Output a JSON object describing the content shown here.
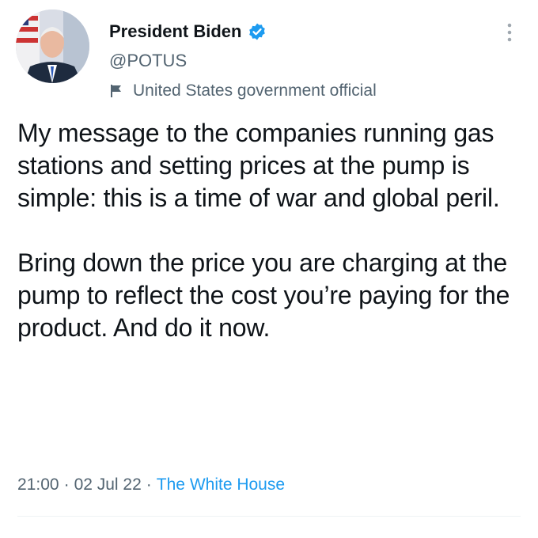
{
  "author": {
    "name": "President Biden",
    "handle": "@POTUS",
    "label": "United States government official",
    "verified": true
  },
  "icons": {
    "verified": "verified-badge-icon",
    "label": "flag-icon",
    "more": "more-vertical-icon"
  },
  "tweet": {
    "text": "My message to the companies running gas stations and setting prices at the pump is simple: this is a time of war and global peril.\n\nBring down the price you are charging at the pump to reflect the cost you’re paying for the product. And do it now.",
    "time": "21:00",
    "date": "02 Jul 22",
    "source": "The White House"
  },
  "colors": {
    "accent": "#1d9bf0",
    "secondary_text": "#536471",
    "text": "#0f1419"
  }
}
